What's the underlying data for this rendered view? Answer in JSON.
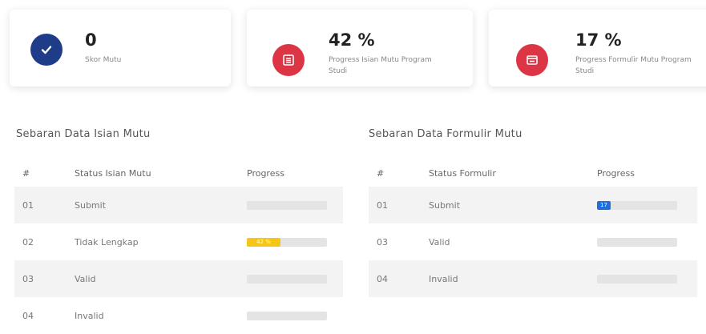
{
  "cards": [
    {
      "value": "0",
      "label": "Skor Mutu",
      "icon": "check-circle-icon",
      "color": "#1f3c88"
    },
    {
      "value": "42 %",
      "label": "Progress Isian Mutu Program Studi",
      "icon": "list-icon",
      "color": "#dc3545"
    },
    {
      "value": "17 %",
      "label": "Progress Formulir Mutu Program Studi",
      "icon": "form-icon",
      "color": "#dc3545"
    }
  ],
  "isian": {
    "title": "Sebaran Data Isian Mutu",
    "headers": {
      "num": "#",
      "status": "Status Isian Mutu",
      "progress": "Progress"
    },
    "rows": [
      {
        "num": "01",
        "status": "Submit",
        "progress": 0,
        "progress_label": "",
        "color": "#f5c518"
      },
      {
        "num": "02",
        "status": "Tidak Lengkap",
        "progress": 0.42,
        "progress_label": "42 %",
        "color": "#f5c518"
      },
      {
        "num": "03",
        "status": "Valid",
        "progress": 0,
        "progress_label": "",
        "color": "#f5c518"
      },
      {
        "num": "04",
        "status": "Invalid",
        "progress": 0,
        "progress_label": "",
        "color": "#f5c518"
      }
    ]
  },
  "formulir": {
    "title": "Sebaran Data Formulir Mutu",
    "headers": {
      "num": "#",
      "status": "Status Formulir",
      "progress": "Progress"
    },
    "rows": [
      {
        "num": "01",
        "status": "Submit",
        "progress": 0.17,
        "progress_label": "17 %",
        "color": "#1e6fd9"
      },
      {
        "num": "03",
        "status": "Valid",
        "progress": 0,
        "progress_label": "",
        "color": "#1e6fd9"
      },
      {
        "num": "04",
        "status": "Invalid",
        "progress": 0,
        "progress_label": "",
        "color": "#1e6fd9"
      }
    ]
  }
}
